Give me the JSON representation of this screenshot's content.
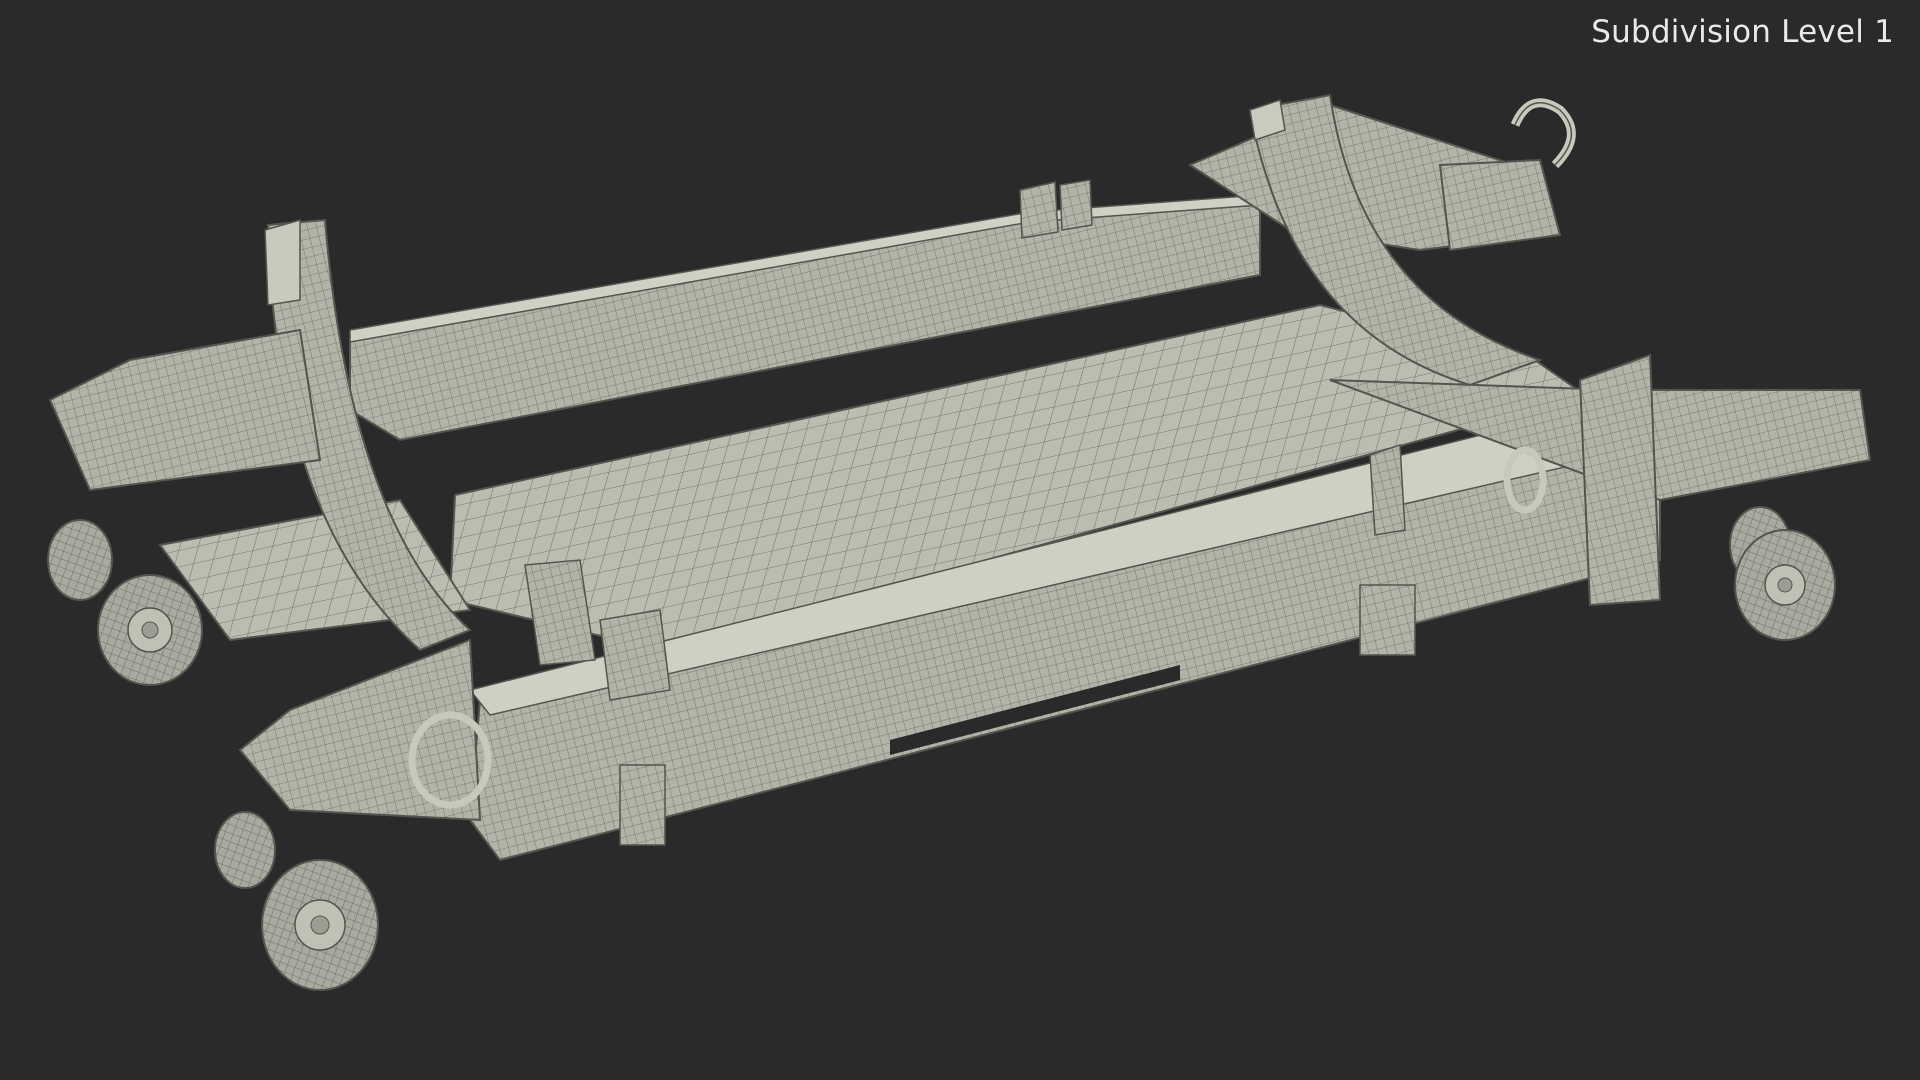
{
  "viewport": {
    "overlay_label": "Subdivision Level 1",
    "background_color": "#2a2a2a",
    "model_fill_color": "#bdbdb2",
    "wire_color": "#6f6f68"
  },
  "model": {
    "subject": "wireframe render of a wheeled cradle cart with four caster wheels",
    "wheel_count": 4
  }
}
